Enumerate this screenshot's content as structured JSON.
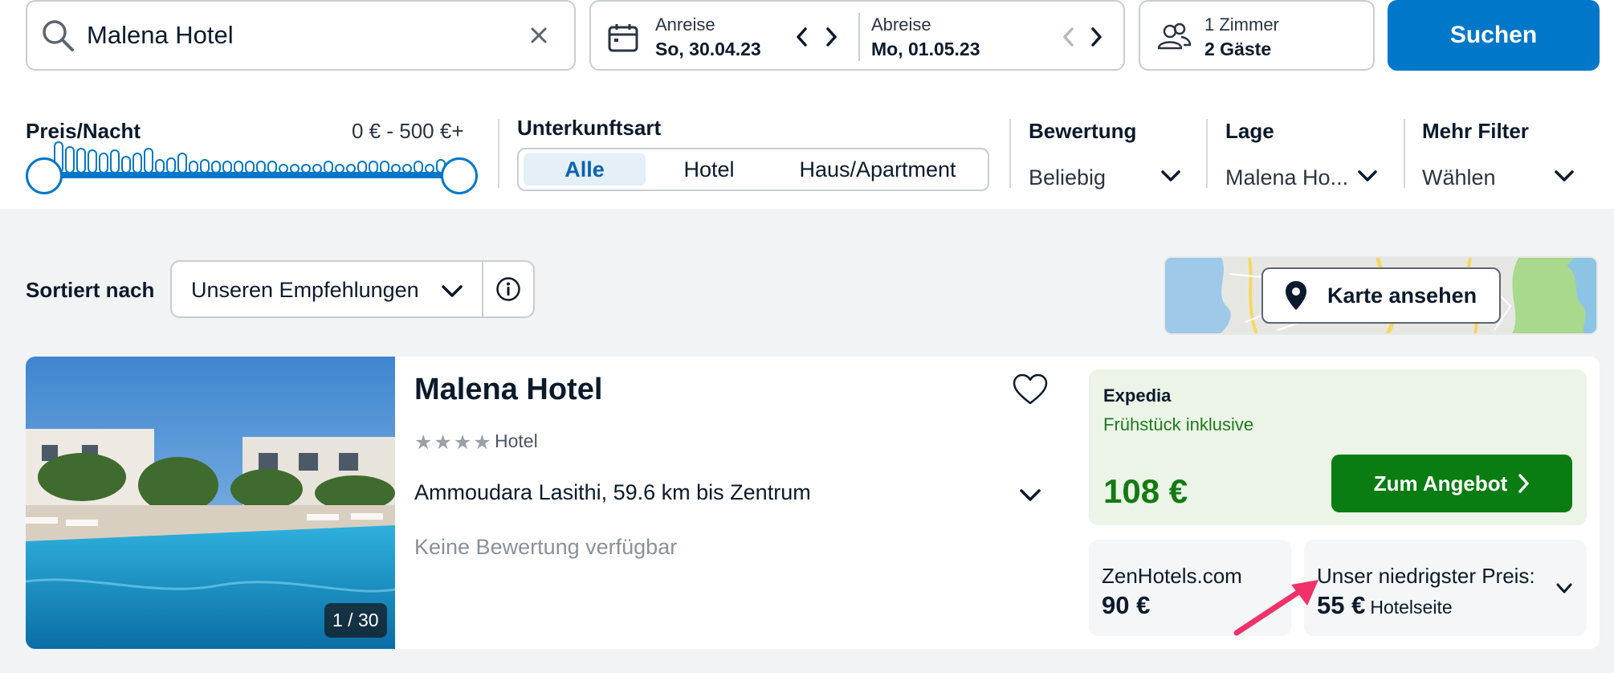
{
  "search": {
    "query": "Malena Hotel",
    "clear_label": "✕"
  },
  "dates": {
    "checkin_label": "Anreise",
    "checkin_value": "So, 30.04.23",
    "checkout_label": "Abreise",
    "checkout_value": "Mo, 01.05.23"
  },
  "guests": {
    "rooms": "1 Zimmer",
    "guests": "2 Gäste"
  },
  "search_button": "Suchen",
  "filters": {
    "price": {
      "title": "Preis/Nacht",
      "range": "0 € - 500 €+"
    },
    "type": {
      "title": "Unterkunftsart",
      "options": [
        "Alle",
        "Hotel",
        "Haus/Apartment"
      ],
      "selected": "Alle"
    },
    "rating": {
      "title": "Bewertung",
      "value": "Beliebig"
    },
    "location": {
      "title": "Lage",
      "value": "Malena Ho..."
    },
    "more": {
      "title": "Mehr Filter",
      "value": "Wählen"
    }
  },
  "sort": {
    "label": "Sortiert nach",
    "value": "Unseren Empfehlungen"
  },
  "map": {
    "button_label": "Karte ansehen"
  },
  "result": {
    "name": "Malena Hotel",
    "stars": 4,
    "type": "Hotel",
    "address": "Ammoudara Lasithi, 59.6 km bis Zentrum",
    "rating": "Keine Bewertung verfügbar",
    "photo_counter": "1 / 30",
    "main_offer": {
      "provider": "Expedia",
      "inclusion": "Frühstück inklusive",
      "price": "108 €",
      "cta": "Zum Angebot"
    },
    "alt_offers": [
      {
        "provider": "ZenHotels.com",
        "price": "90 €"
      },
      {
        "provider": "Unser niedrigster Preis:",
        "price": "55 €",
        "sub": "Hotelseite"
      }
    ]
  },
  "colors": {
    "primary": "#0077c8",
    "deal_green": "#0a7d12",
    "offer_bg": "#ebf4e6",
    "annotation": "#f0316a"
  }
}
